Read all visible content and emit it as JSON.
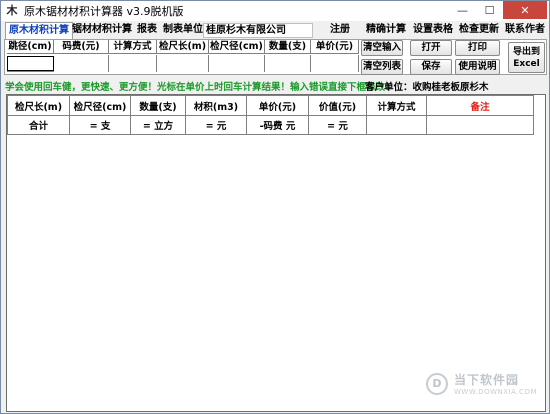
{
  "window": {
    "title": "原木锯材材积计算器 v3.9脱机版",
    "icon": "wood-logo-icon",
    "controls": {
      "minimize": "—",
      "maximize": "☐",
      "close": "✕"
    }
  },
  "tabs": [
    {
      "label": "原木材积计算",
      "active": true
    },
    {
      "label": "锯材材积计算",
      "active": false
    },
    {
      "label": "报表",
      "active": false
    },
    {
      "label": "制表单位：",
      "active": false
    }
  ],
  "unit_value": "桂原杉木有限公司",
  "menu": {
    "register": "注册",
    "precise": "精确计算",
    "settings": "设置表格",
    "check_update": "检查更新",
    "contact": "联系作者"
  },
  "input_grid": {
    "headers": [
      "跳径(cm)",
      "码费(元)",
      "计算方式",
      "检尺长(m)",
      "检尺径(cm)",
      "数量(支)",
      "单价(元)"
    ]
  },
  "buttons": {
    "clear_input": "清空输入",
    "open": "打开",
    "print": "打印",
    "clear_list": "清空列表",
    "save": "保存",
    "help": "使用说明",
    "export_line1": "导出到",
    "export_line2": "Excel"
  },
  "hint_text": "学会使用回车健，更快速、更方便！光标在单价上时回车计算结果！输入错误直接下框修改！",
  "customer": {
    "label": "客户单位：",
    "value": "收购桂老板原杉木"
  },
  "results": {
    "headers": [
      "检尺长(m)",
      "检尺径(cm)",
      "数量(支)",
      "材积(m3)",
      "单价(元)",
      "价值(元)",
      "计算方式",
      "备注"
    ],
    "summary": [
      "合计",
      "= 支",
      "= 立方",
      "= 元",
      "-码费 元",
      "= 元",
      "",
      ""
    ]
  },
  "watermark": {
    "cn": "当下软件园",
    "en": "WWW.DOWNXIA.COM",
    "logo": "d-logo-icon"
  }
}
